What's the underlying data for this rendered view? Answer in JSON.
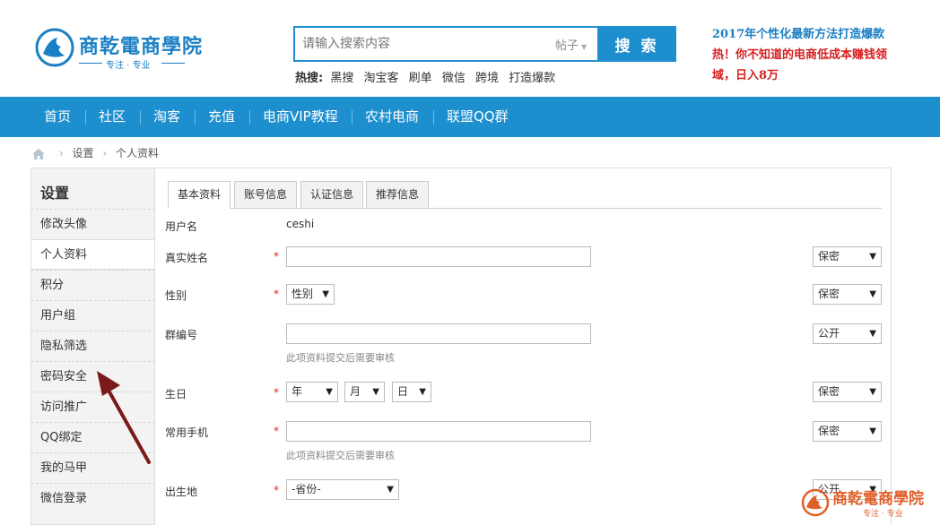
{
  "header": {
    "logo_text": "商乾電商學院",
    "logo_slogan": "专注 · 专业",
    "search": {
      "placeholder": "请输入搜索内容",
      "type": "帖子",
      "button": "搜 索"
    },
    "hot_label": "热搜:",
    "hot_items": [
      "黑搜",
      "淘宝客",
      "刷单",
      "微信",
      "跨境",
      "打造爆款"
    ],
    "promo_line1": "2017年个性化最新方法打造爆款",
    "promo_line2": "热！你不知道的电商低成本赚钱领域，日入8万"
  },
  "nav": [
    "首页",
    "社区",
    "淘客",
    "充值",
    "电商VIP教程",
    "农村电商",
    "联盟QQ群"
  ],
  "breadcrumb": [
    "设置",
    "个人资料"
  ],
  "sidebar": {
    "title": "设置",
    "items": [
      "修改头像",
      "个人资料",
      "积分",
      "用户组",
      "隐私筛选",
      "密码安全",
      "访问推广",
      "QQ绑定",
      "我的马甲",
      "微信登录"
    ],
    "active_index": 1
  },
  "tabs": [
    "基本资料",
    "账号信息",
    "认证信息",
    "推荐信息"
  ],
  "form": {
    "username_label": "用户名",
    "username_value": "ceshi",
    "realname_label": "真实姓名",
    "gender_label": "性别",
    "gender_select": "性别",
    "group_label": "群编号",
    "review_hint": "此项资料提交后需要审核",
    "birthday_label": "生日",
    "birth_year": "年",
    "birth_month": "月",
    "birth_day": "日",
    "phone_label": "常用手机",
    "birthplace_label": "出生地",
    "province_select": "-省份-",
    "privacy_secret": "保密",
    "privacy_public": "公开",
    "required_mark": "*"
  },
  "watermark": {
    "text": "商乾電商學院",
    "slogan": "专注 · 专业"
  },
  "colors": {
    "brand_blue": "#1d8ece",
    "promo_red": "#d61f1f",
    "required_red": "#e02020",
    "annotation": "#7a1a1a",
    "watermark_orange": "#e0602a"
  }
}
